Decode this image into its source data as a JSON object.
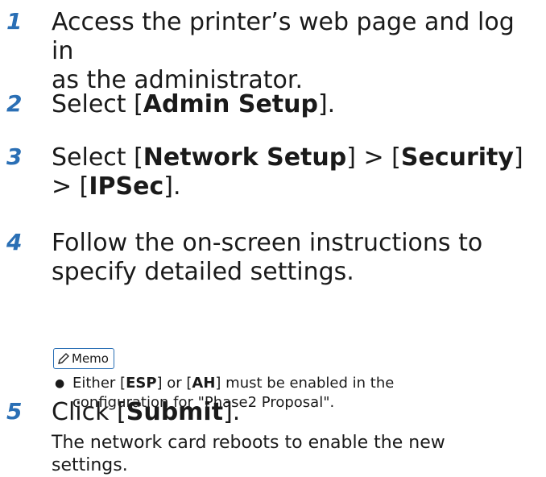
{
  "steps": [
    {
      "num": "1",
      "line1": "Access the printer’s web page and log in",
      "line2": "as the administrator."
    },
    {
      "num": "2",
      "pre": "Select [",
      "bold": "Admin Setup",
      "post": "]."
    },
    {
      "num": "3",
      "pre": "Select [",
      "bold1": "Network Setup",
      "mid1": "] > [",
      "bold2": "Security",
      "mid2": "]",
      "line2_pre": "> [",
      "bold3": "IPSec",
      "line2_post": "]."
    },
    {
      "num": "4",
      "line1": "Follow the on-screen instructions to",
      "line2": "specify detailed settings."
    },
    {
      "num": "5",
      "pre": "Click [",
      "bold": "Submit",
      "post": "]."
    }
  ],
  "memo": {
    "label": "Memo",
    "bullet": "●",
    "text_pre": "Either [",
    "bold1": "ESP",
    "text_mid": "] or [",
    "bold2": "AH",
    "text_post": "] must be enabled in the",
    "line2": "configuration for \"Phase2 Proposal\"."
  },
  "result_text": {
    "line1": "The network card reboots to enable the new",
    "line2": "settings."
  },
  "colors": {
    "step_number": "#2a6fb5",
    "memo_border": "#2a6fb5"
  }
}
